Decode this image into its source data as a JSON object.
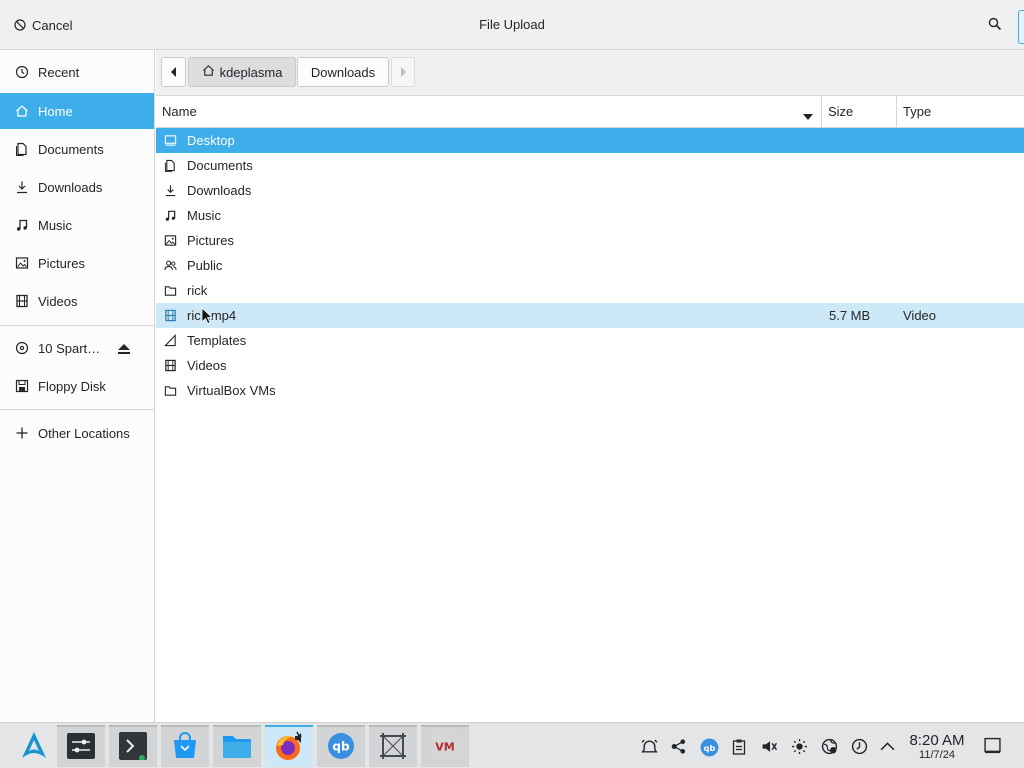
{
  "dialog": {
    "title": "File Upload",
    "cancel_label": "Cancel"
  },
  "sidebar": {
    "items": [
      {
        "label": "Recent",
        "icon": "clock-icon"
      },
      {
        "label": "Home",
        "icon": "home-icon",
        "active": true
      },
      {
        "label": "Documents",
        "icon": "documents-icon"
      },
      {
        "label": "Downloads",
        "icon": "download-icon"
      },
      {
        "label": "Music",
        "icon": "music-note-icon"
      },
      {
        "label": "Pictures",
        "icon": "picture-icon"
      },
      {
        "label": "Videos",
        "icon": "film-icon"
      }
    ],
    "devices": [
      {
        "label": "10 Spart…",
        "icon": "disc-icon",
        "ejectable": true
      },
      {
        "label": "Floppy Disk",
        "icon": "floppy-icon"
      }
    ],
    "other_locations": {
      "label": "Other Locations",
      "icon": "plus-icon"
    }
  },
  "pathbar": {
    "segments": [
      {
        "label": "kdeplasma",
        "icon": "home-icon"
      },
      {
        "label": "Downloads"
      }
    ]
  },
  "filelist": {
    "columns": {
      "name": "Name",
      "size": "Size",
      "type": "Type"
    },
    "rows": [
      {
        "name": "Desktop",
        "icon": "desktop-icon",
        "size": "",
        "type": "",
        "state": "selected"
      },
      {
        "name": "Documents",
        "icon": "documents-icon",
        "size": "",
        "type": ""
      },
      {
        "name": "Downloads",
        "icon": "download-icon",
        "size": "",
        "type": ""
      },
      {
        "name": "Music",
        "icon": "music-note-icon",
        "size": "",
        "type": ""
      },
      {
        "name": "Pictures",
        "icon": "picture-icon",
        "size": "",
        "type": ""
      },
      {
        "name": "Public",
        "icon": "users-icon",
        "size": "",
        "type": ""
      },
      {
        "name": "rick",
        "icon": "folder-icon",
        "size": "",
        "type": ""
      },
      {
        "name": "rick.mp4",
        "icon": "film-icon",
        "size": "5.7 MB",
        "type": "Video",
        "state": "hover"
      },
      {
        "name": "Templates",
        "icon": "template-icon",
        "size": "",
        "type": ""
      },
      {
        "name": "Videos",
        "icon": "film-icon",
        "size": "",
        "type": ""
      },
      {
        "name": "VirtualBox VMs",
        "icon": "folder-icon",
        "size": "",
        "type": ""
      }
    ]
  },
  "taskbar": {
    "launcher_icon": "arch-logo-icon",
    "apps": [
      {
        "name": "settings-app",
        "icon": "sliders-icon"
      },
      {
        "name": "terminal-app",
        "icon": "terminal-icon"
      },
      {
        "name": "software-store-app",
        "icon": "store-bag-icon"
      },
      {
        "name": "file-manager-app",
        "icon": "folder-icon"
      },
      {
        "name": "firefox-app",
        "icon": "firefox-icon"
      },
      {
        "name": "qbittorrent-app",
        "icon": "qbittorrent-icon"
      },
      {
        "name": "screenshot-app",
        "icon": "crop-frame-icon"
      },
      {
        "name": "virtualbox-app",
        "icon": "virtualbox-icon"
      }
    ],
    "tray_icons": [
      "alarm-icon",
      "network-share-icon",
      "qbittorrent-icon",
      "clipboard-icon",
      "volume-muted-icon",
      "brightness-icon",
      "network-globe-icon",
      "updates-icon",
      "chevron-up-icon"
    ],
    "clock": {
      "time": "8:20 AM",
      "date": "11/7/24"
    },
    "show_desktop_icon": "show-desktop-icon",
    "colors": {
      "accent": "#3daee9"
    }
  }
}
